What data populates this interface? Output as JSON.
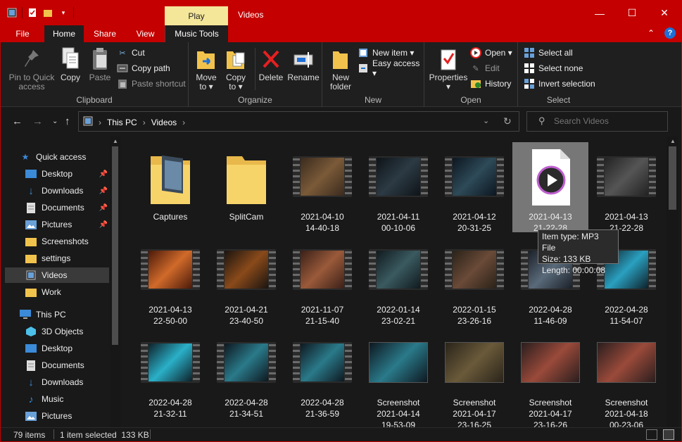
{
  "window": {
    "title": "Videos",
    "context_tab": "Play"
  },
  "tabs": [
    "File",
    "Home",
    "Share",
    "View",
    "Music Tools"
  ],
  "ribbon": {
    "clipboard": {
      "label": "Clipboard",
      "pin": "Pin to Quick\naccess",
      "copy": "Copy",
      "paste": "Paste",
      "cut": "Cut",
      "copy_path": "Copy path",
      "paste_shortcut": "Paste shortcut"
    },
    "organize": {
      "label": "Organize",
      "move_to": "Move\nto ▾",
      "copy_to": "Copy\nto ▾",
      "delete": "Delete",
      "rename": "Rename"
    },
    "new": {
      "label": "New",
      "new_folder": "New\nfolder",
      "new_item": "New item ▾",
      "easy_access": "Easy access ▾"
    },
    "open": {
      "label": "Open",
      "properties": "Properties\n▾",
      "open": "Open ▾",
      "edit": "Edit",
      "history": "History"
    },
    "select": {
      "label": "Select",
      "select_all": "Select all",
      "select_none": "Select none",
      "invert": "Invert selection"
    }
  },
  "address": {
    "path": [
      "This PC",
      "Videos"
    ]
  },
  "search": {
    "placeholder": "Search Videos"
  },
  "nav": {
    "quick_access": "Quick access",
    "items": [
      "Desktop",
      "Downloads",
      "Documents",
      "Pictures",
      "Screenshots",
      "settings",
      "Videos",
      "Work"
    ],
    "this_pc": "This PC",
    "pc_items": [
      "3D Objects",
      "Desktop",
      "Documents",
      "Downloads",
      "Music",
      "Pictures"
    ]
  },
  "files": [
    {
      "name": "Captures",
      "type": "folder"
    },
    {
      "name": "SplitCam",
      "type": "folder"
    },
    {
      "name": "2021-04-10\n14-40-18",
      "type": "video"
    },
    {
      "name": "2021-04-11\n00-10-06",
      "type": "video"
    },
    {
      "name": "2021-04-12\n20-31-25",
      "type": "video"
    },
    {
      "name": "2021-04-13\n21-22-28",
      "type": "mp3"
    },
    {
      "name": "2021-04-13\n21-22-28",
      "type": "video"
    },
    {
      "name": "2021-04-13\n22-50-00",
      "type": "video"
    },
    {
      "name": "2021-04-21\n23-40-50",
      "type": "video"
    },
    {
      "name": "2021-11-07\n21-15-40",
      "type": "video"
    },
    {
      "name": "2022-01-14\n23-02-21",
      "type": "video"
    },
    {
      "name": "2022-01-15\n23-26-16",
      "type": "video"
    },
    {
      "name": "2022-04-28\n11-46-09",
      "type": "video"
    },
    {
      "name": "2022-04-28\n11-54-07",
      "type": "video"
    },
    {
      "name": "2022-04-28\n21-32-11",
      "type": "video"
    },
    {
      "name": "2022-04-28\n21-34-51",
      "type": "video"
    },
    {
      "name": "2022-04-28\n21-36-59",
      "type": "video"
    },
    {
      "name": "Screenshot\n2021-04-14\n19-53-09",
      "type": "image"
    },
    {
      "name": "Screenshot\n2021-04-17\n23-16-25",
      "type": "image"
    },
    {
      "name": "Screenshot\n2021-04-17\n23-16-26",
      "type": "image"
    },
    {
      "name": "Screenshot\n2021-04-18\n00-23-06",
      "type": "image"
    }
  ],
  "tooltip": {
    "line1": "Item type: MP3 File",
    "line2": "Size: 133 KB",
    "line3": "Length: 00:00:08"
  },
  "status": {
    "count": "79 items",
    "selected": "1 item selected  133 KB"
  }
}
